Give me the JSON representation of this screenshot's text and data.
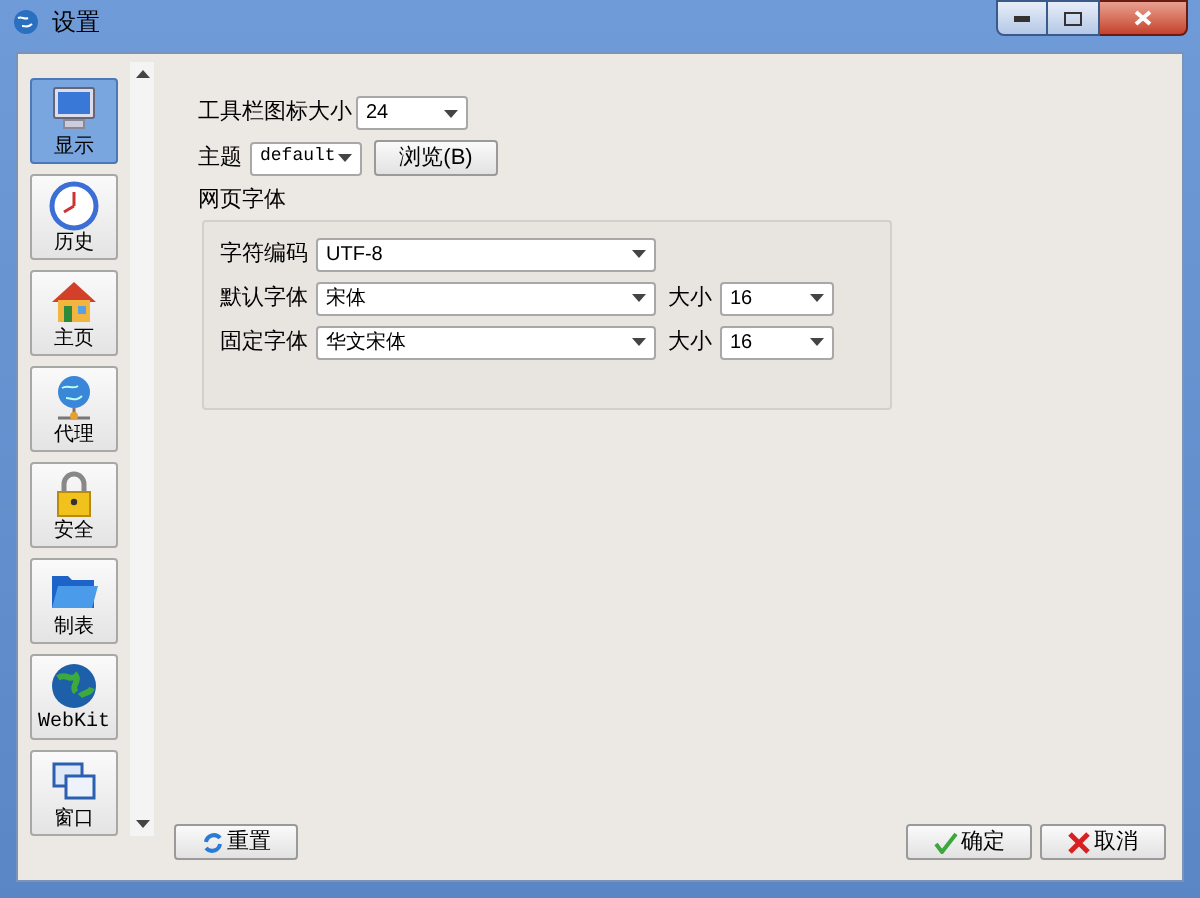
{
  "window": {
    "title": "设置"
  },
  "sidebar": {
    "items": [
      {
        "kind": "monitor",
        "label": "显示",
        "selected": true
      },
      {
        "kind": "clock",
        "label": "历史",
        "selected": false
      },
      {
        "kind": "house",
        "label": "主页",
        "selected": false
      },
      {
        "kind": "network",
        "label": "代理",
        "selected": false
      },
      {
        "kind": "lock",
        "label": "安全",
        "selected": false
      },
      {
        "kind": "folder",
        "label": "制表",
        "selected": false
      },
      {
        "kind": "globe",
        "label": "WebKit",
        "selected": false
      },
      {
        "kind": "windows",
        "label": "窗口",
        "selected": false
      }
    ]
  },
  "toolbar_icon_size": {
    "label": "工具栏图标大小",
    "value": "24"
  },
  "theme": {
    "label": "主题",
    "value": "default",
    "browse_button": "浏览(B)"
  },
  "web_fonts": {
    "title": "网页字体",
    "encoding": {
      "label": "字符编码",
      "value": "UTF-8"
    },
    "rows": [
      {
        "label": "默认字体",
        "value": "宋体",
        "size_label": "大小",
        "size": "16"
      },
      {
        "label": "固定字体",
        "value": "华文宋体",
        "size_label": "大小",
        "size": "16"
      }
    ]
  },
  "buttons": {
    "reset": "重置",
    "ok": "确定",
    "cancel": "取消"
  }
}
